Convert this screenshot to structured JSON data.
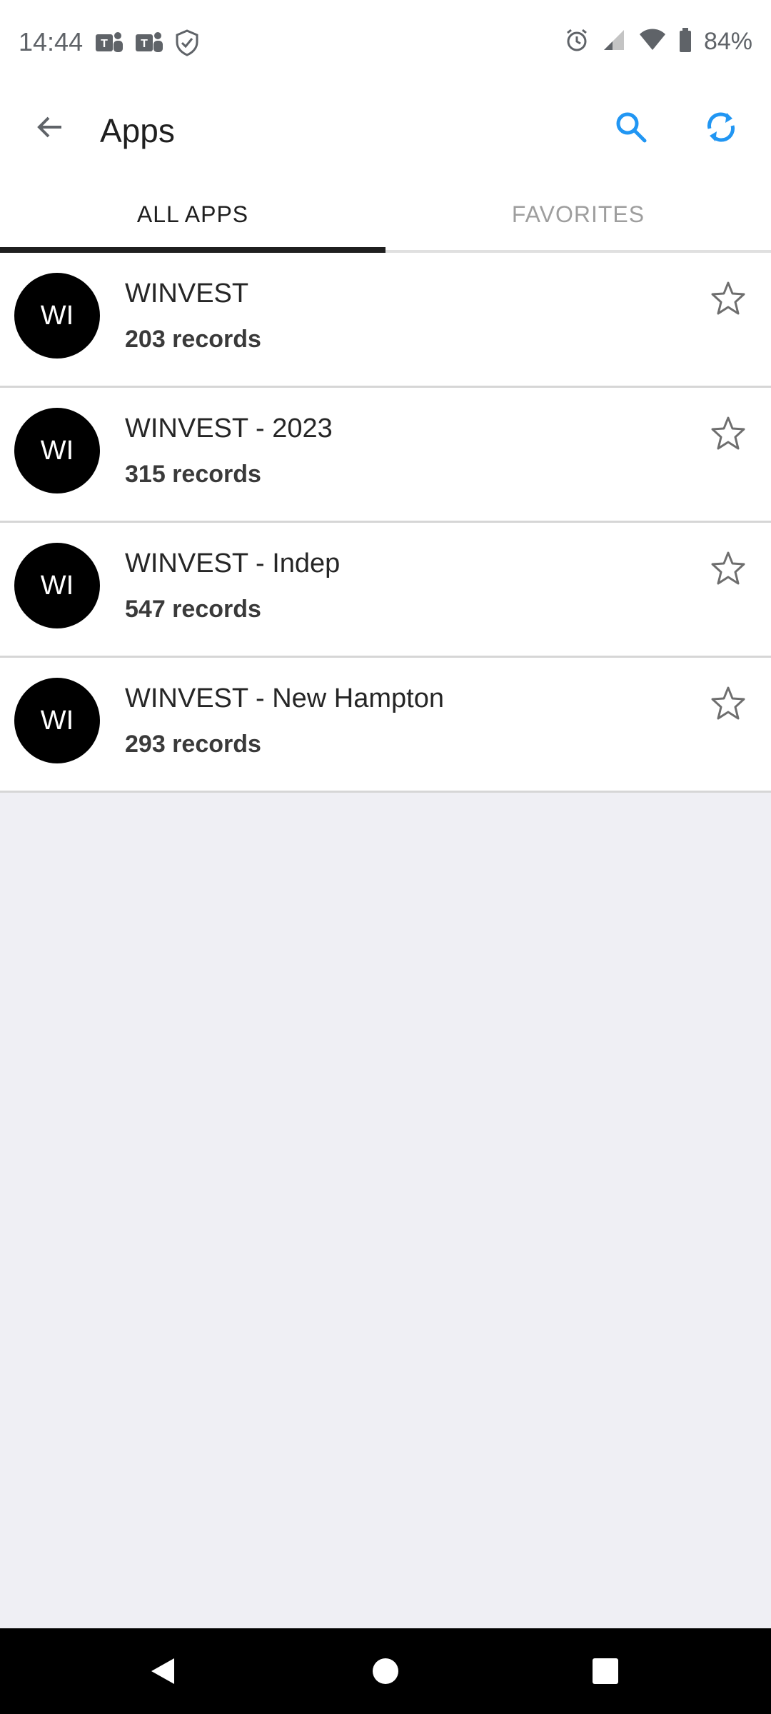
{
  "status_bar": {
    "time": "14:44",
    "left_icons": [
      "teams-icon",
      "teams-icon",
      "shield-icon"
    ],
    "right_icons": [
      "alarm-icon",
      "signal-icon",
      "wifi-icon",
      "battery-icon"
    ],
    "battery": "84%"
  },
  "app_bar": {
    "title": "Apps",
    "accent_color": "#2196f3"
  },
  "tabs": [
    {
      "label": "ALL APPS",
      "active": true
    },
    {
      "label": "FAVORITES",
      "active": false
    }
  ],
  "apps": [
    {
      "initials": "WI",
      "name": "WINVEST",
      "records": "203 records"
    },
    {
      "initials": "WI",
      "name": "WINVEST - 2023",
      "records": "315 records"
    },
    {
      "initials": "WI",
      "name": "WINVEST - Indep",
      "records": "547 records"
    },
    {
      "initials": "WI",
      "name": "WINVEST - New Hampton",
      "records": "293 records"
    }
  ]
}
